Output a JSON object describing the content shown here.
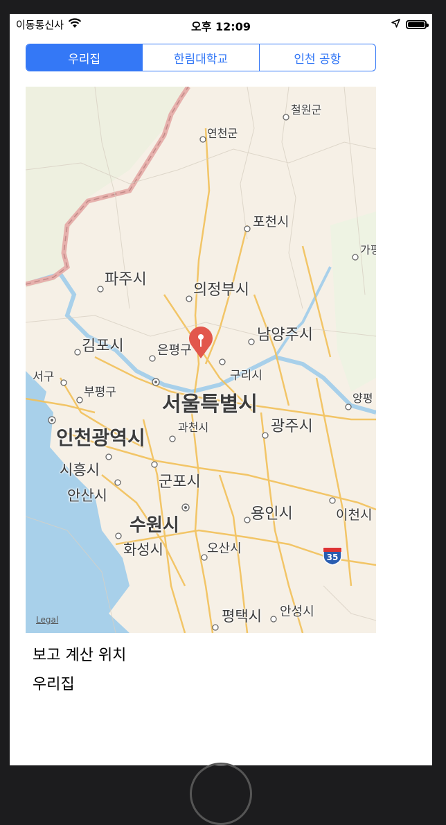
{
  "status_bar": {
    "carrier": "이동통신사",
    "time": "오후 12:09",
    "wifi_icon": "wifi-icon",
    "location_icon": "location-arrow-icon",
    "battery_level": 1.0
  },
  "segments": {
    "selected_index": 0,
    "items": [
      "우리집",
      "한림대학교",
      "인천 공항"
    ]
  },
  "map": {
    "places": [
      {
        "name": "철원군"
      },
      {
        "name": "연천군"
      },
      {
        "name": "포천시"
      },
      {
        "name": "가평"
      },
      {
        "name": "파주시"
      },
      {
        "name": "의정부시"
      },
      {
        "name": "김포시"
      },
      {
        "name": "은평구"
      },
      {
        "name": "남양주시"
      },
      {
        "name": "서구"
      },
      {
        "name": "부평구"
      },
      {
        "name": "구리시"
      },
      {
        "name": "서울특별시"
      },
      {
        "name": "양평"
      },
      {
        "name": "인천광역시"
      },
      {
        "name": "과천시"
      },
      {
        "name": "광주시"
      },
      {
        "name": "시흥시"
      },
      {
        "name": "군포시"
      },
      {
        "name": "안산시"
      },
      {
        "name": "용인시"
      },
      {
        "name": "이천시"
      },
      {
        "name": "수원시"
      },
      {
        "name": "화성시"
      },
      {
        "name": "오산시"
      },
      {
        "name": "평택시"
      },
      {
        "name": "안성시"
      }
    ],
    "route_shield": "35",
    "legal": "Legal",
    "pin_icon": "map-pin-icon"
  },
  "info": {
    "line1": "보고 계산 위치",
    "line2": "우리집"
  }
}
